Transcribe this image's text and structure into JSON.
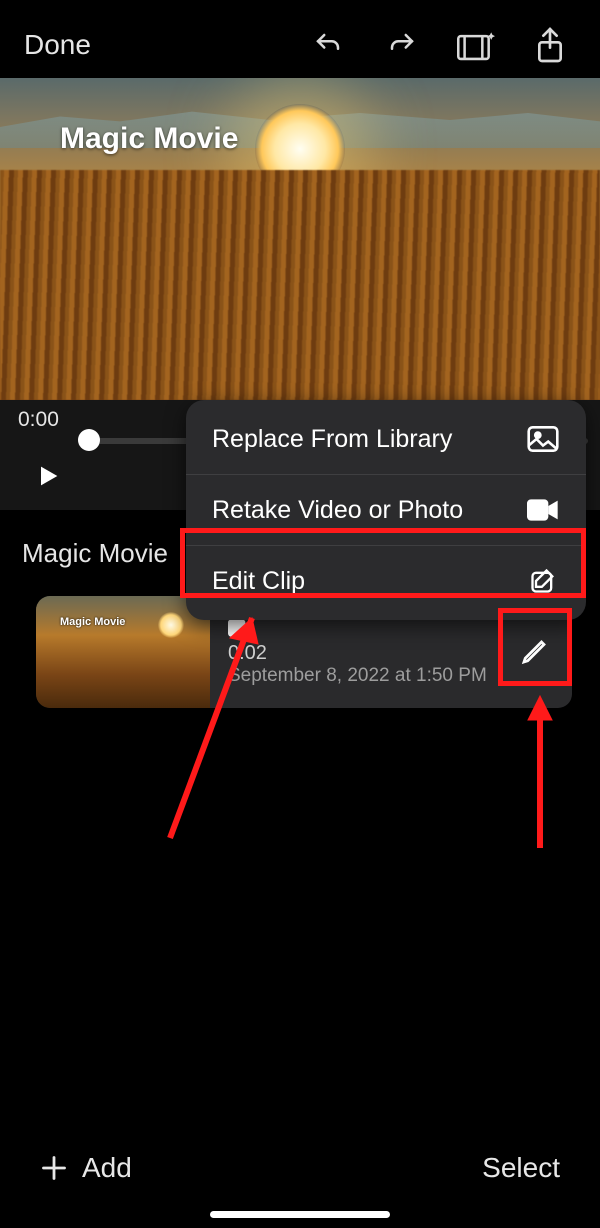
{
  "toolbar": {
    "done_label": "Done"
  },
  "preview": {
    "overlay_title": "Magic Movie"
  },
  "scrubber": {
    "time_label": "0:00"
  },
  "project_title": "Magic Movie",
  "popover": {
    "items": [
      {
        "label": "Replace From Library",
        "icon": "image-icon"
      },
      {
        "label": "Retake Video or Photo",
        "icon": "video-camera-icon"
      },
      {
        "label": "Edit Clip",
        "icon": "compose-icon"
      }
    ]
  },
  "clip": {
    "thumb_label": "Magic Movie",
    "duration": "0:02",
    "date": "September 8, 2022 at 1:50 PM"
  },
  "bottom": {
    "add_label": "Add",
    "select_label": "Select"
  }
}
